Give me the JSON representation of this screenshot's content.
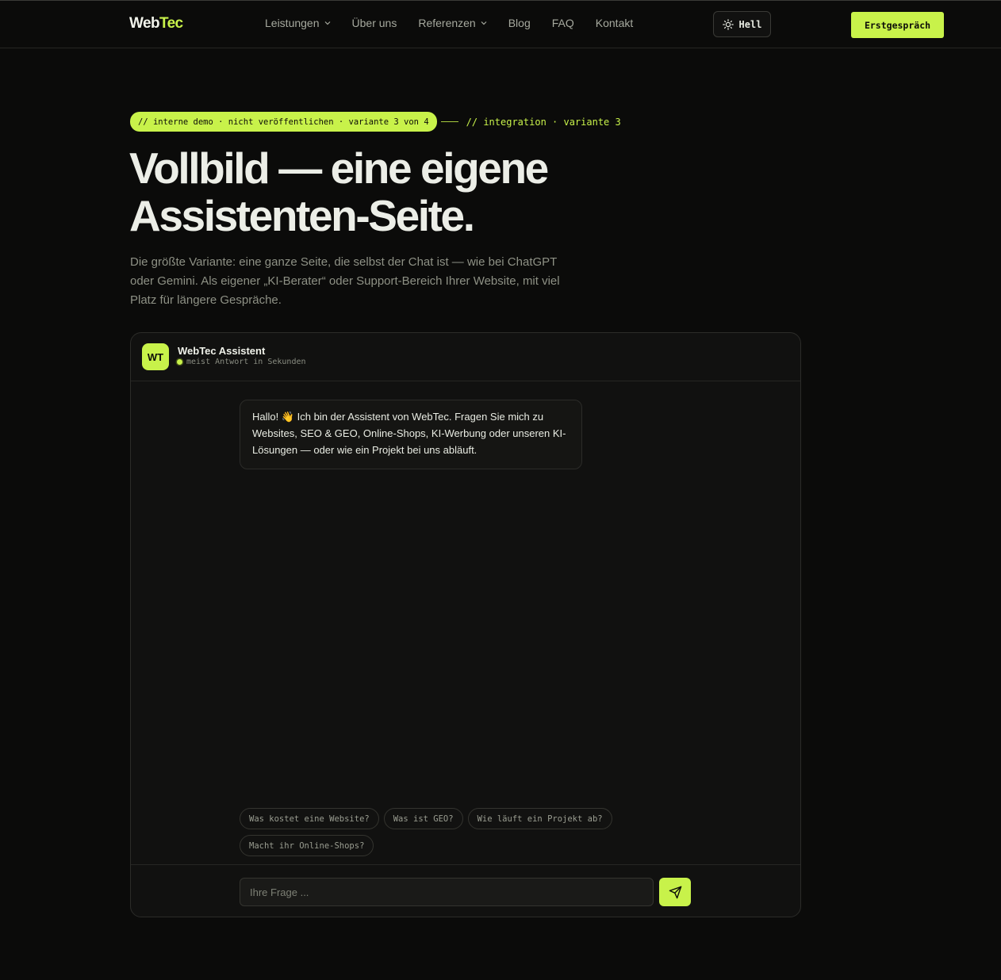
{
  "header": {
    "logo_main": "Web",
    "logo_accent": "Tec",
    "nav": [
      {
        "label": "Leistungen",
        "dropdown": true
      },
      {
        "label": "Über uns",
        "dropdown": false
      },
      {
        "label": "Referenzen",
        "dropdown": true
      },
      {
        "label": "Blog",
        "dropdown": false
      },
      {
        "label": "FAQ",
        "dropdown": false
      },
      {
        "label": "Kontakt",
        "dropdown": false
      }
    ],
    "theme_label": "Hell",
    "cta_label": "Erstgespräch"
  },
  "hero": {
    "pill": "// interne demo · nicht veröffentlichen · variante 3 von 4",
    "tag": "// integration · variante 3",
    "title_line1": "Vollbild — eine eigene",
    "title_line2": "Assistenten-Seite.",
    "lead": "Die größte Variante: eine ganze Seite, die selbst der Chat ist — wie bei ChatGPT oder Gemini. Als eigener „KI-Berater“ oder Support-Bereich Ihrer Website, mit viel Platz für längere Gespräche."
  },
  "chat": {
    "avatar": "WT",
    "name": "WebTec Assistent",
    "status": "meist Antwort in Sekunden",
    "message": "Hallo! 👋 Ich bin der Assistent von WebTec. Fragen Sie mich zu Websites, SEO & GEO, Online-Shops, KI-Werbung oder unseren KI-Lösungen — oder wie ein Projekt bei uns abläuft.",
    "chips": [
      "Was kostet eine Website?",
      "Was ist GEO?",
      "Wie läuft ein Projekt ab?",
      "Macht ihr Online-Shops?"
    ],
    "input_placeholder": "Ihre Frage ..."
  },
  "colors": {
    "accent": "#c8f24a",
    "background": "#0b0b0a",
    "panel": "#111110"
  },
  "icons": {
    "theme": "sun-icon",
    "send": "send-icon",
    "dropdown": "chevron-down-icon"
  }
}
